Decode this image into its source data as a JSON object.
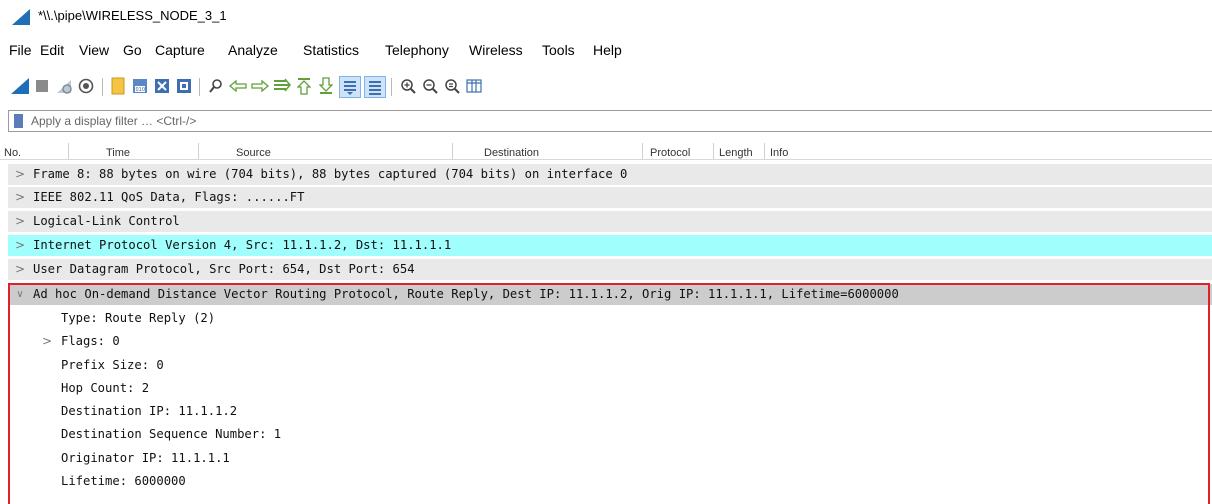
{
  "window": {
    "title": "*\\\\.\\pipe\\WIRELESS_NODE_3_1",
    "brand_color": "#1f6fb8"
  },
  "menu": [
    "File",
    "Edit",
    "View",
    "Go",
    "Capture",
    "Analyze",
    "Statistics",
    "Telephony",
    "Wireless",
    "Tools",
    "Help"
  ],
  "toolbar": {
    "icons": [
      "start-capture-icon",
      "stop-capture-icon",
      "restart-capture-icon",
      "capture-options-icon",
      "open-file-icon",
      "save-file-icon",
      "close-file-icon",
      "reload-file-icon",
      "find-packet-icon",
      "go-back-icon",
      "go-forward-icon",
      "go-to-packet-icon",
      "go-first-icon",
      "go-last-icon",
      "auto-scroll-icon",
      "colorize-icon",
      "zoom-in-icon",
      "zoom-out-icon",
      "zoom-normal-icon",
      "resize-columns-icon"
    ]
  },
  "filter": {
    "placeholder": "Apply a display filter … <Ctrl-/>"
  },
  "columns": [
    "No.",
    "Time",
    "Source",
    "Destination",
    "Protocol",
    "Length",
    "Info"
  ],
  "details": {
    "rows": [
      {
        "expander": ">",
        "text": "Frame 8: 88 bytes on wire (704 bits), 88 bytes captured (704 bits) on interface 0",
        "style": "grey"
      },
      {
        "expander": ">",
        "text": "IEEE 802.11 QoS Data, Flags: ......FT",
        "style": "grey"
      },
      {
        "expander": ">",
        "text": "Logical-Link Control",
        "style": "grey"
      },
      {
        "expander": ">",
        "text": "Internet Protocol Version 4, Src: 11.1.1.2, Dst: 11.1.1.1",
        "style": "highlight"
      },
      {
        "expander": ">",
        "text": "User Datagram Protocol, Src Port: 654, Dst Port: 654",
        "style": "grey"
      },
      {
        "expander": "∨",
        "text": "Ad hoc On-demand Distance Vector Routing Protocol, Route Reply, Dest IP: 11.1.1.2, Orig IP: 11.1.1.1, Lifetime=6000000",
        "style": "selected"
      },
      {
        "expander": "",
        "text": "Type: Route Reply (2)",
        "style": "child"
      },
      {
        "expander": ">",
        "text": "Flags: 0",
        "style": "child"
      },
      {
        "expander": "",
        "text": "Prefix Size: 0",
        "style": "child"
      },
      {
        "expander": "",
        "text": "Hop Count: 2",
        "style": "child"
      },
      {
        "expander": "",
        "text": "Destination IP: 11.1.1.2",
        "style": "child"
      },
      {
        "expander": "",
        "text": "Destination Sequence Number: 1",
        "style": "child"
      },
      {
        "expander": "",
        "text": "Originator IP: 11.1.1.1",
        "style": "child"
      },
      {
        "expander": "",
        "text": "Lifetime: 6000000",
        "style": "child"
      }
    ]
  },
  "colors": {
    "highlight_row": "#a0fefd",
    "selected_row": "#cccccc",
    "grey_row": "#e9e9e9",
    "annotation_box": "#e0202a"
  }
}
